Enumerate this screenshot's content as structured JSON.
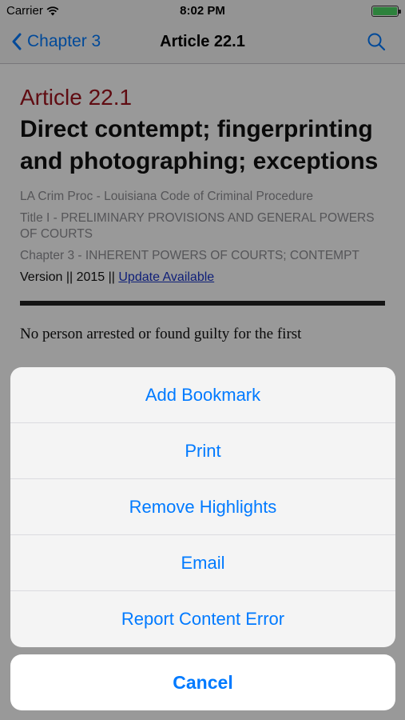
{
  "status_bar": {
    "carrier": "Carrier",
    "time": "8:02 PM",
    "battery_color": "#4cd964"
  },
  "nav": {
    "back_label": "Chapter 3",
    "title": "Article 22.1",
    "search_icon": "search-icon"
  },
  "article": {
    "number": "Article 22.1",
    "title": "Direct contempt; fingerprinting and photographing; exceptions",
    "meta": [
      "LA Crim Proc - Louisiana Code of Criminal Procedure",
      "Title I - PRELIMINARY PROVISIONS AND GENERAL POWERS OF COURTS",
      "Chapter 3 - INHERENT POWERS OF COURTS; CONTEMPT"
    ],
    "version_prefix": "Version || 2015 || ",
    "update_link": "Update Available",
    "body_start": "No person arrested or found guilty for the first"
  },
  "action_sheet": {
    "items": [
      "Add Bookmark",
      "Print",
      "Remove Highlights",
      "Email",
      "Report Content Error"
    ],
    "cancel": "Cancel"
  },
  "colors": {
    "accent": "#007aff",
    "article_number": "#a0141e",
    "link": "#1a35c9"
  }
}
